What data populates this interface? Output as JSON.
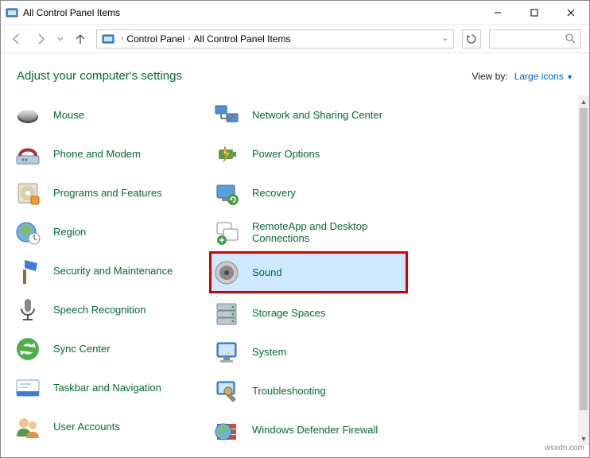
{
  "title": "All Control Panel Items",
  "breadcrumb": [
    "Control Panel",
    "All Control Panel Items"
  ],
  "header": {
    "title": "Adjust your computer's settings",
    "viewByLabel": "View by:",
    "viewByValue": "Large icons"
  },
  "left": [
    {
      "label": "Mouse"
    },
    {
      "label": "Phone and Modem"
    },
    {
      "label": "Programs and Features"
    },
    {
      "label": "Region"
    },
    {
      "label": "Security and Maintenance"
    },
    {
      "label": "Speech Recognition"
    },
    {
      "label": "Sync Center"
    },
    {
      "label": "Taskbar and Navigation"
    },
    {
      "label": "User Accounts"
    }
  ],
  "right": [
    {
      "label": "Network and Sharing Center"
    },
    {
      "label": "Power Options"
    },
    {
      "label": "Recovery"
    },
    {
      "label": "RemoteApp and Desktop Connections"
    },
    {
      "label": "Sound",
      "highlighted": true
    },
    {
      "label": "Storage Spaces"
    },
    {
      "label": "System"
    },
    {
      "label": "Troubleshooting"
    },
    {
      "label": "Windows Defender Firewall"
    }
  ],
  "watermark": "wsxdn.com"
}
